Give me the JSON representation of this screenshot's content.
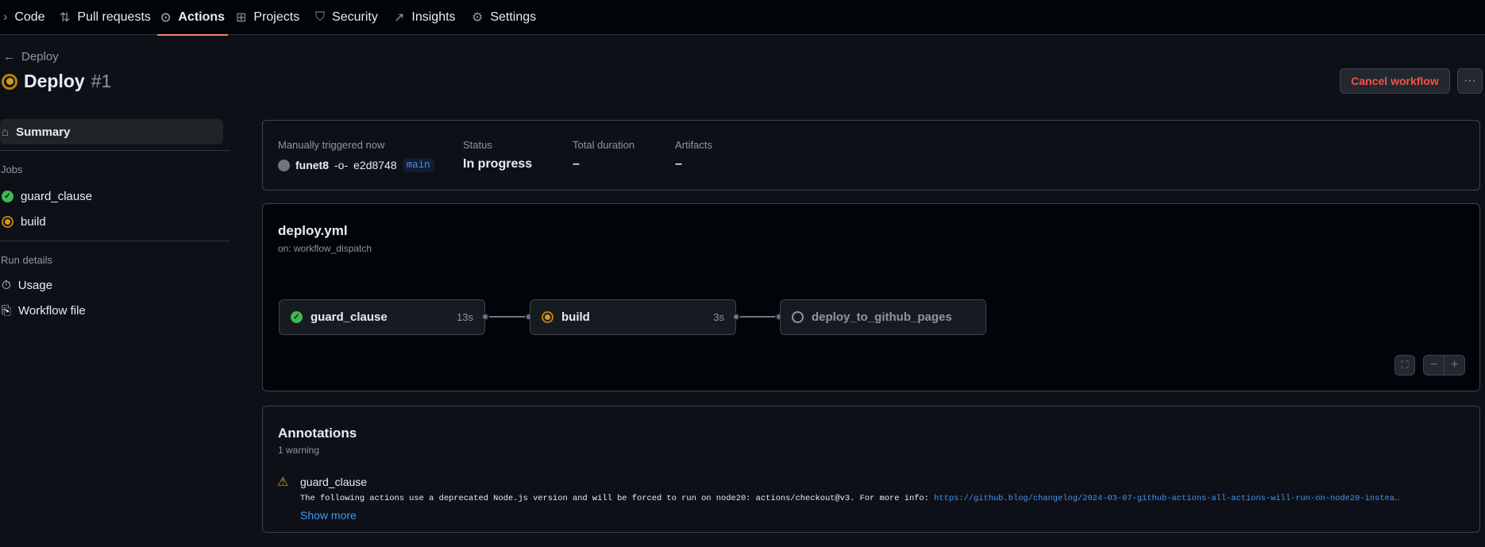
{
  "nav": {
    "items": [
      {
        "label": "Code",
        "icon": "code-icon"
      },
      {
        "label": "Pull requests",
        "icon": "pull-request-icon"
      },
      {
        "label": "Actions",
        "icon": "play-icon",
        "active": true
      },
      {
        "label": "Projects",
        "icon": "table-icon"
      },
      {
        "label": "Security",
        "icon": "shield-icon"
      },
      {
        "label": "Insights",
        "icon": "graph-icon"
      },
      {
        "label": "Settings",
        "icon": "gear-icon"
      }
    ]
  },
  "header": {
    "back_label": "Deploy",
    "title": "Deploy",
    "run_number": "#1",
    "cancel_label": "Cancel workflow",
    "more_label": "···"
  },
  "sidebar": {
    "summary_label": "Summary",
    "jobs_heading": "Jobs",
    "jobs": [
      {
        "label": "guard_clause",
        "status": "success"
      },
      {
        "label": "build",
        "status": "in_progress"
      }
    ],
    "run_details_heading": "Run details",
    "details": [
      {
        "label": "Usage"
      },
      {
        "label": "Workflow file"
      }
    ]
  },
  "summary": {
    "trigger_label": "Manually triggered now",
    "user": "funet8",
    "commit": "e2d8748",
    "branch": "main",
    "status_label": "Status",
    "status_value": "In progress",
    "duration_label": "Total duration",
    "duration_value": "–",
    "artifacts_label": "Artifacts",
    "artifacts_value": "–"
  },
  "graph": {
    "file": "deploy.yml",
    "trigger": "on: workflow_dispatch",
    "jobs": [
      {
        "name": "guard_clause",
        "duration": "13s",
        "status": "success"
      },
      {
        "name": "build",
        "duration": "3s",
        "status": "in_progress"
      },
      {
        "name": "deploy_to_github_pages",
        "duration": "",
        "status": "pending"
      }
    ],
    "zoom_minus": "−",
    "zoom_plus": "+"
  },
  "annotations": {
    "title": "Annotations",
    "count": "1 warning",
    "items": [
      {
        "job": "guard_clause",
        "message": "The following actions use a deprecated Node.js version and will be forced to run on node20: actions/checkout@v3. For more info: ",
        "link": "https://github.blog/changelog/2024-03-07-github-actions-all-actions-will-run-on-node20-instea…",
        "show_more": "Show more"
      }
    ]
  },
  "colors": {
    "accent": "#f78166",
    "success": "#3fb950",
    "in_progress": "#d29922",
    "danger": "#f85149",
    "link": "#4493f8",
    "warning": "#d29922"
  }
}
